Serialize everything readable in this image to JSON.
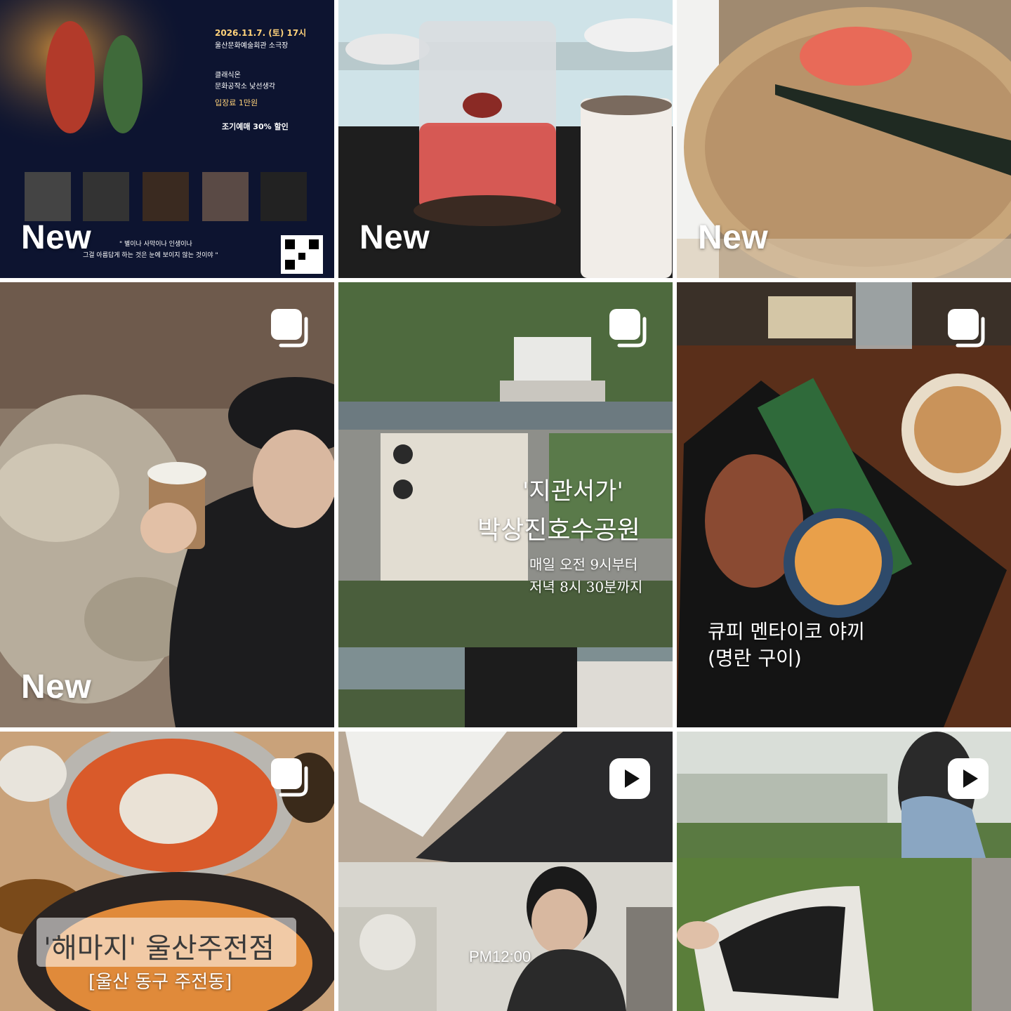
{
  "grid": {
    "tiles": [
      {
        "new_badge": "New",
        "poster": {
          "date": "2026.11.7. (토) 17시",
          "venue": "울산문화예술회관 소극장",
          "host1": "클래식온",
          "host2": "문화공작소 낯선생각",
          "fee": "입장료 1만원",
          "discount": "조기예매 30% 할인",
          "quote1": "\" 별이나 사막이나 인생이나",
          "quote2": "그걸 아름답게 하는 것은 눈에 보이지 않는 것이야 \""
        }
      },
      {
        "new_badge": "New"
      },
      {
        "new_badge": "New"
      },
      {
        "new_badge": "New"
      },
      {
        "title": "'지관서가'",
        "subtitle": "박상진호수공원",
        "line1": "매일 오전 9시부터",
        "line2": "저녁 8시 30분까지"
      },
      {
        "line1": "큐피 멘타이코 야끼",
        "line2": "(명란 구이)"
      },
      {
        "title": "'해마지' 울산주전점",
        "subtitle": "[울산 동구 주전동]"
      },
      {
        "time": "PM12:00"
      },
      {}
    ]
  },
  "icons": {
    "carousel": "carousel-icon",
    "reel": "reel-play-icon"
  },
  "colors": {
    "badge_text": "#ffffff",
    "background": "#ffffff"
  }
}
